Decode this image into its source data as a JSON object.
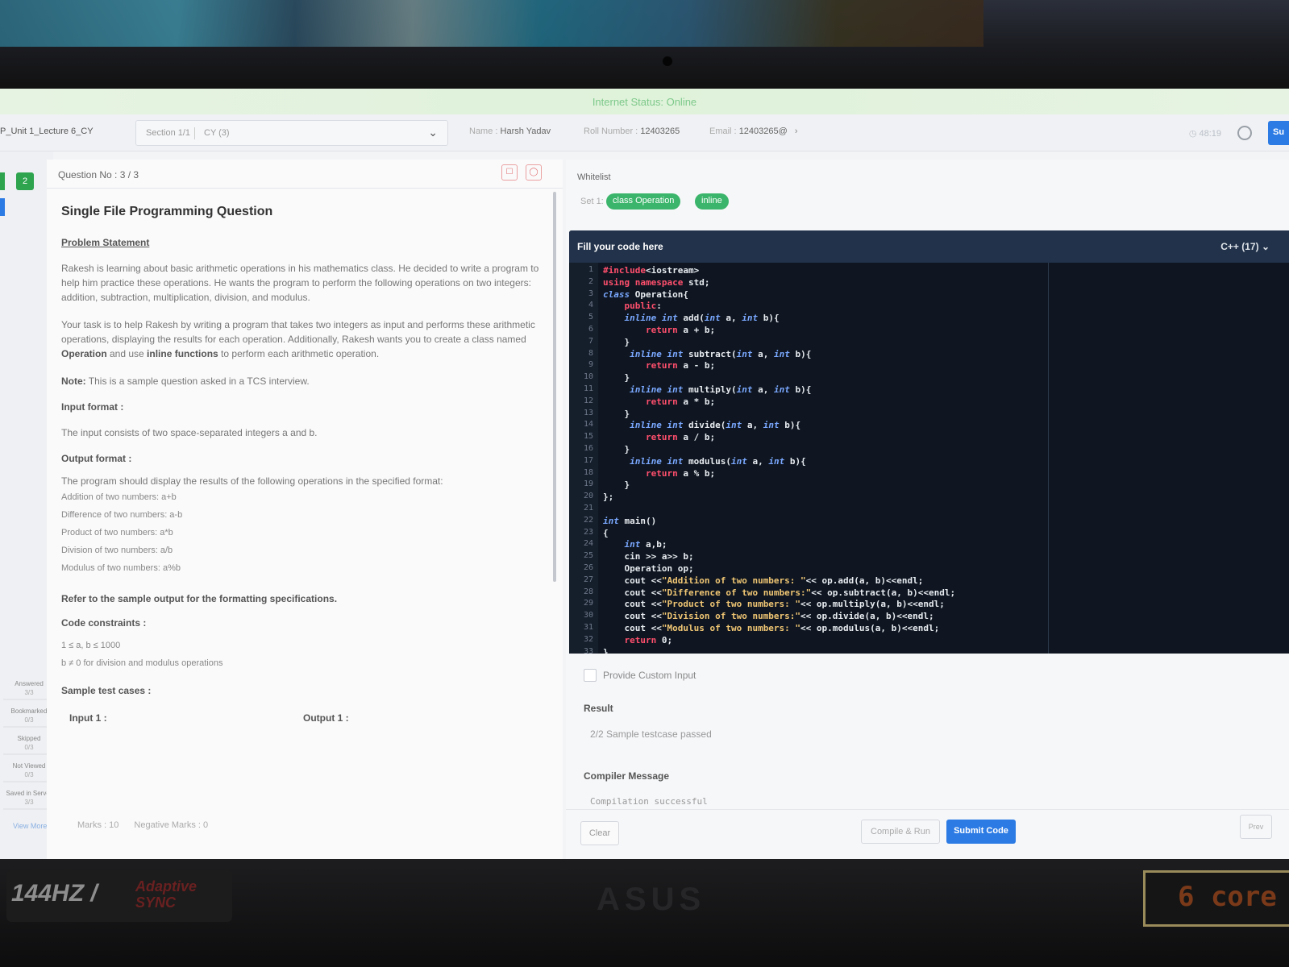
{
  "status_bar": {
    "text": "Internet Status: Online"
  },
  "top_bar": {
    "breadcrumb": "P_Unit 1_Lecture 6_CY",
    "section_label": "Section 1/1",
    "section_value": "CY (3)",
    "name_label": "Name :",
    "name_value": "Harsh Yadav",
    "roll_label": "Roll Number :",
    "roll_value": "12403265",
    "email_label": "Email :",
    "email_value": "12403265@",
    "timer": "48:19",
    "submit_label": "Su"
  },
  "left_rail": {
    "current_question": "2",
    "legend": [
      {
        "label": "Answered",
        "count": "3/3"
      },
      {
        "label": "Bookmarked",
        "count": "0/3"
      },
      {
        "label": "Skipped",
        "count": "0/3"
      },
      {
        "label": "Not Viewed",
        "count": "0/3"
      },
      {
        "label": "Saved in Server",
        "count": "3/3"
      }
    ],
    "view_more": "View More"
  },
  "question": {
    "number": "Question No : 3 / 3",
    "title": "Single File Programming Question",
    "problem_heading": "Problem Statement",
    "para1": "Rakesh is learning about basic arithmetic operations in his mathematics class. He decided to write a program to help him practice these operations. He wants the program to perform the following operations on two integers: addition, subtraction, multiplication, division, and modulus.",
    "para2_a": "Your task is to help Rakesh by writing a program that takes two integers as input and performs these arithmetic operations, displaying the results for each operation. Additionally, Rakesh wants you to create a class named ",
    "para2_b": "Operation",
    "para2_c": " and use ",
    "para2_d": "inline functions",
    "para2_e": " to perform each arithmetic operation.",
    "note_label": "Note:",
    "note_text": " This is a sample question asked in a TCS interview.",
    "input_heading": "Input format :",
    "input_text": "The input consists of two space-separated integers a and b.",
    "output_heading": "Output format :",
    "output_text": "The program should display the results of the following operations in the specified format:",
    "output_lines": [
      "Addition of two numbers: a+b",
      "Difference of two numbers: a-b",
      "Product of two numbers: a*b",
      "Division of two numbers: a/b",
      "Modulus of two numbers: a%b"
    ],
    "refer_text": "Refer to the sample output for the formatting specifications.",
    "constraints_heading": "Code constraints :",
    "constraint1": "1 ≤ a, b ≤ 1000",
    "constraint2": "b ≠ 0 for division and modulus operations",
    "samples_heading": "Sample test cases :",
    "input1_label": "Input 1 :",
    "output1_label": "Output 1 :",
    "marks": "Marks : 10",
    "negative_marks": "Negative Marks : 0"
  },
  "right": {
    "whitelist_label": "Whitelist",
    "set_label": "Set 1:",
    "pills": [
      "class Operation",
      "inline"
    ],
    "editor_title": "Fill your code here",
    "language": "C++ (17)",
    "code": [
      "#include<iostream>",
      "using namespace std;",
      "class Operation{",
      "    public:",
      "    inline int add(int a, int b){",
      "        return a + b;",
      "    }",
      "     inline int subtract(int a, int b){",
      "        return a - b;",
      "    }",
      "     inline int multiply(int a, int b){",
      "        return a * b;",
      "    }",
      "     inline int divide(int a, int b){",
      "        return a / b;",
      "    }",
      "     inline int modulus(int a, int b){",
      "        return a % b;",
      "    }",
      "};",
      "",
      "int main()",
      "{",
      "    int a,b;",
      "    cin >> a>> b;",
      "    Operation op;",
      "    cout <<\"Addition of two numbers: \"<< op.add(a, b)<<endl;",
      "    cout <<\"Difference of two numbers:\"<< op.subtract(a, b)<<endl;",
      "    cout <<\"Product of two numbers: \"<< op.multiply(a, b)<<endl;",
      "    cout <<\"Division of two numbers:\"<< op.divide(a, b)<<endl;",
      "    cout <<\"Modulus of two numbers: \"<< op.modulus(a, b)<<endl;",
      "    return 0;",
      "}"
    ],
    "custom_input_label": "Provide Custom Input",
    "result_heading": "Result",
    "result_value": "2/2 Sample testcase passed",
    "compiler_heading": "Compiler Message",
    "compiler_value": "Compilation successful",
    "clear_label": "Clear",
    "compile_label": "Compile & Run",
    "submit_label": "Submit Code",
    "next_label": "Prev"
  },
  "laptop": {
    "hz_sticker": "144HZ /",
    "adaptive_sync": "Adaptive SYNC",
    "brand": "ASUS",
    "core_sticker": "6 core"
  }
}
